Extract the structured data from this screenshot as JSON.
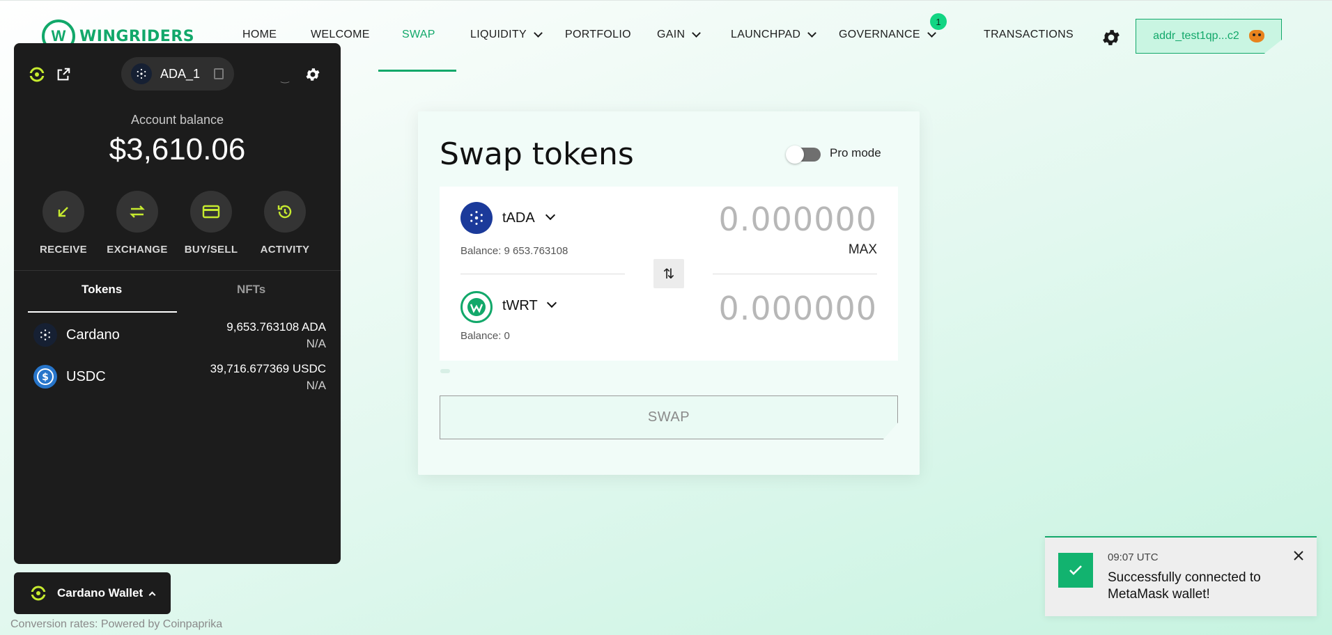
{
  "brand": {
    "name": "WINGRIDERS",
    "accent": "#12a86a"
  },
  "nav": {
    "items": [
      {
        "label": "HOME"
      },
      {
        "label": "WELCOME"
      },
      {
        "label": "SWAP"
      },
      {
        "label": "LIQUIDITY"
      },
      {
        "label": "PORTFOLIO"
      },
      {
        "label": "GAIN"
      },
      {
        "label": "LAUNCHPAD"
      },
      {
        "label": "GOVERNANCE"
      },
      {
        "label": "TRANSACTIONS"
      }
    ],
    "active": "SWAP",
    "governance_badge": "1",
    "address": "addr_test1qp...c2"
  },
  "wallet": {
    "account_name": "ADA_1",
    "balance_label": "Account balance",
    "balance_value": "$3,610.06",
    "actions": [
      {
        "label": "RECEIVE",
        "icon": "arrow-down-left-icon"
      },
      {
        "label": "EXCHANGE",
        "icon": "exchange-icon"
      },
      {
        "label": "BUY/SELL",
        "icon": "card-icon"
      },
      {
        "label": "ACTIVITY",
        "icon": "history-icon"
      }
    ],
    "tabs": {
      "tokens": "Tokens",
      "nfts": "NFTs"
    },
    "tokens": [
      {
        "name": "Cardano",
        "amount": "9,653.763108 ADA",
        "fiat": "N/A",
        "icon": "cardano-icon"
      },
      {
        "name": "USDC",
        "amount": "39,716.677369 USDC",
        "fiat": "N/A",
        "icon": "usdc-icon"
      }
    ],
    "toggle_label": "Cardano Wallet"
  },
  "footer": {
    "note": "Conversion rates: Powered by Coinpaprika"
  },
  "swap": {
    "title": "Swap tokens",
    "pro_mode_label": "Pro mode",
    "pro_mode_on": false,
    "from": {
      "symbol": "tADA",
      "amount": "0.000000",
      "balance": "Balance: 9 653.763108",
      "max_label": "MAX"
    },
    "to": {
      "symbol": "tWRT",
      "amount": "0.000000",
      "balance": "Balance: 0"
    },
    "button_label": "SWAP"
  },
  "toast": {
    "time": "09:07 UTC",
    "message": "Successfully connected to MetaMask wallet!"
  }
}
